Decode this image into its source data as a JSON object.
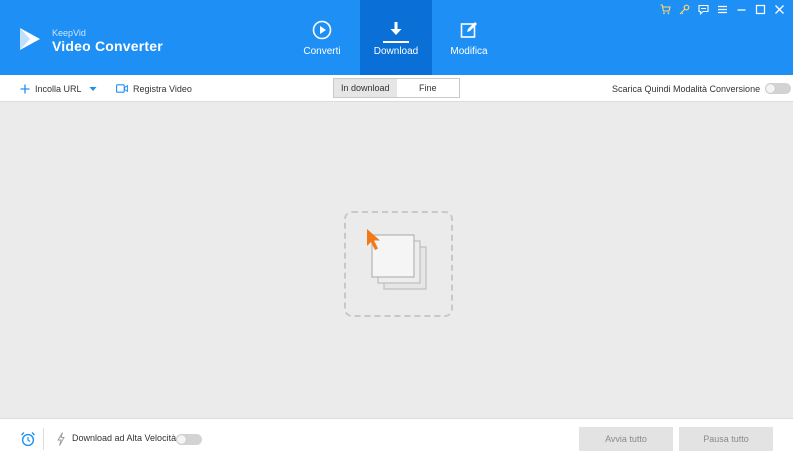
{
  "app": {
    "brand_small": "KeepVid",
    "brand_name": "Video Converter",
    "accent": "#1e90f5",
    "accent_dark": "#0a6fd6"
  },
  "tabs": [
    {
      "label": "Converti",
      "icon": "play-circle-icon",
      "active": false
    },
    {
      "label": "Download",
      "icon": "download-icon",
      "active": true
    },
    {
      "label": "Modifica",
      "icon": "edit-icon",
      "active": false
    }
  ],
  "window_controls": [
    "cart-icon",
    "key-icon",
    "chat-icon",
    "menu-icon",
    "minimize-icon",
    "maximize-icon",
    "close-icon"
  ],
  "toolbar": {
    "paste_url": "Incolla URL",
    "record_video": "Registra Video",
    "segments": [
      {
        "label": "In download",
        "active": true
      },
      {
        "label": "Fine",
        "active": false
      }
    ],
    "download_then_convert": "Scarica Quindi Modalità Conversione",
    "download_then_convert_on": false
  },
  "footer": {
    "high_speed": "Download ad Alta Velocità",
    "high_speed_on": false,
    "start_all": "Avvia tutto",
    "pause_all": "Pausa tutto"
  }
}
